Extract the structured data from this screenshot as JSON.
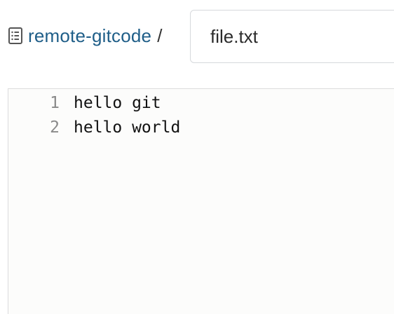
{
  "breadcrumb": {
    "icon": "repo-icon",
    "repo_name": "remote-gitcode",
    "separator": "/"
  },
  "file_name_input": {
    "value": "file.txt"
  },
  "editor": {
    "lines": [
      {
        "number": "1",
        "text": "hello git"
      },
      {
        "number": "2",
        "text": "hello world"
      }
    ]
  }
}
